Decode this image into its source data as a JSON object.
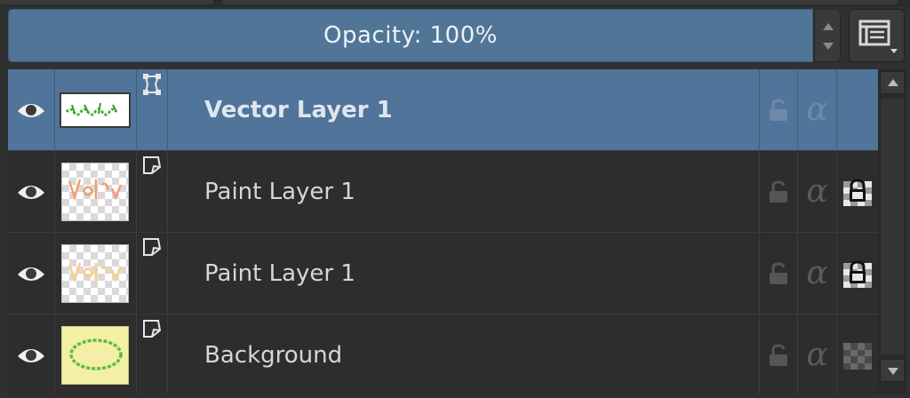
{
  "opacity": {
    "label": "Opacity:",
    "value": "100%"
  },
  "icons": {
    "visibility": "eye-icon",
    "view_mode": "view-mode-icon",
    "lock": "lock-icon",
    "alpha": "alpha-lock-icon",
    "inherit_alpha": "inherit-alpha-icon"
  },
  "alpha_glyph": "α",
  "layers": [
    {
      "name": "Vector Layer 1",
      "type": "vector",
      "selected": true,
      "visible": true,
      "inherit_alpha": false
    },
    {
      "name": "Paint Layer 1",
      "type": "paint",
      "selected": false,
      "visible": true,
      "inherit_alpha": true
    },
    {
      "name": "Paint Layer 1",
      "type": "paint",
      "selected": false,
      "visible": true,
      "inherit_alpha": true
    },
    {
      "name": "Background",
      "type": "paint",
      "selected": false,
      "visible": true,
      "inherit_alpha": false
    }
  ],
  "colors": {
    "selection": "#50749a",
    "opacity_bar": "#507596",
    "panel": "#2d2d2d"
  }
}
